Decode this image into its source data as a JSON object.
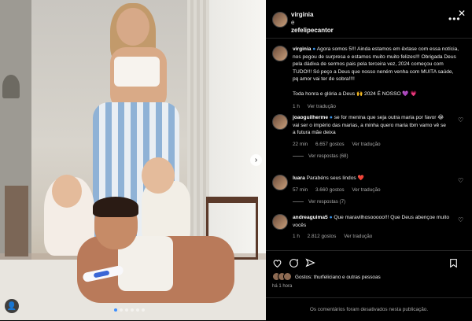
{
  "post": {
    "authors": [
      "virginia",
      "e",
      "zefelipecantor"
    ],
    "caption": {
      "user": "virginia",
      "text": "Agora somos 5!!! Ainda estamos em êxtase com essa notícia, nos pegou de surpresa e estamos muito muito felizes!!! Obrigada Deus pela dádiva de sermos pais pela terceira vez, 2024 começou com TUDO!!! Só peço a Deus que nosso neném venha com MUITA saúde, pq amor vai ter de sobra!!!!",
      "text2": "Toda honra e glória a Deus 🙌 2024 É NOSSO 💜 💗",
      "time": "1 h",
      "translate": "Ver tradução"
    },
    "comments": [
      {
        "user": "joaoguilherme",
        "text": "se for menina que seja outra maria por favor 😂 vai ser o império das marias, a minha quero maria tbm vamo vê se a futura mãe deixa",
        "time": "22 min",
        "likes": "6.657 gostos",
        "translate": "Ver tradução",
        "replies": "Ver respostas (68)"
      },
      {
        "user": "luara",
        "text": "Parabéns seus lindos ❤️",
        "time": "57 min",
        "likes": "3.660 gostos",
        "translate": "Ver tradução",
        "replies": "Ver respostas (7)"
      },
      {
        "user": "andreaguima5",
        "text": "Que maravilhosooooo!!! Que Deus abençoe muito vocês",
        "time": "1 h",
        "likes": "2.812 gostos",
        "translate": "Ver tradução",
        "replies": "Ver respostas"
      }
    ],
    "liked_by": "Gostos: thurfeliciano e outras pessoas",
    "time_ago": "há 1 hora",
    "footer": "Os comentários foram desativados nesta publicação."
  },
  "ui": {
    "more": "•••",
    "close": "✕",
    "next": "›",
    "tag": "👤"
  },
  "colors": {
    "background": "#000000",
    "verified": "#3897f0",
    "active_dot": "#3d8fff"
  }
}
